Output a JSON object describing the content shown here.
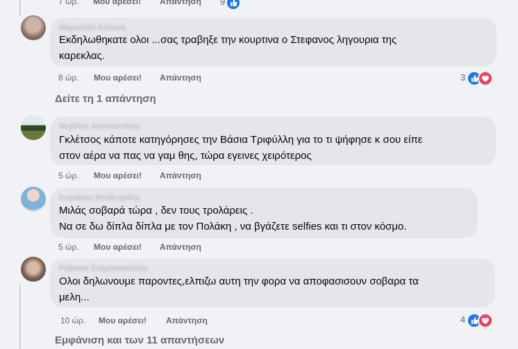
{
  "colors": {
    "like": "#1877f2",
    "love": "#f33e58",
    "bubble": "#e4e6eb",
    "meta": "#65676b"
  },
  "top_row": {
    "time": "7 ώρ.",
    "like": "Μου αρέσει!",
    "reply": "Απάντηση",
    "reactions": "9"
  },
  "comments": [
    {
      "author": "Μαρκέλλα Κλίωση",
      "lines": [
        "Εκδηλωθηκατε ολοι ...σας τραβηξε την κουρτινα ο Στεφανος ληγουρια της",
        "καρεκλας."
      ],
      "time": "8 ώρ.",
      "like": "Μου αρέσει!",
      "reply": "Απάντηση",
      "reactions": "3",
      "reaction_icons": [
        "like-icon",
        "love-icon"
      ]
    },
    {
      "author": "Μιχάλης Αυγουστάκης",
      "lines": [
        "Γκλέτσος κάποτε κατηγόρησες την Βάσια Τριφύλλη για το τι ψήφησε κ σου είπε",
        "στον αέρα να πας να γαμ θης, τώρα εγεινες χειρότερος"
      ],
      "time": "5 ώρ.",
      "like": "Μου αρέσει!",
      "reply": "Απάντηση"
    },
    {
      "author": "Κυριάκος Θεοδωρίδης",
      "lines": [
        "Μιλάς σοβαρά τώρα , δεν τους τρολάρεις .",
        "Να σε δω δίπλα δίπλα με τον Πολάκη , να βγάζετε selfies και τι στον κόσμο."
      ],
      "time": "5 ώρ.",
      "like": "Μου αρέσει!",
      "reply": "Απάντηση"
    },
    {
      "author": "Ρεβέκκα Σταματοπούλου",
      "lines": [
        "Ολοι δηλωνουμε παροντες,ελπιζω αυτη την φορα να αποφασισουν σοβαρα τα",
        "μελη..."
      ],
      "time": "10 ώρ.",
      "like": "Μου αρέσει!",
      "reply": "Απάντηση",
      "reactions": "4",
      "reaction_icons": [
        "like-icon",
        "love-icon"
      ]
    }
  ],
  "view_one_reply": "Δείτε τη 1 απάντηση",
  "view_all_replies": "Εμφάνιση και των 11 απαντήσεων"
}
